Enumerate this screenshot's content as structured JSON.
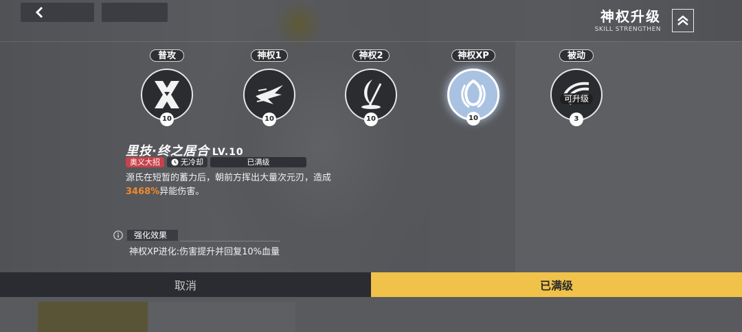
{
  "header": {
    "title": "神权升级",
    "subtitle": "SKILL STRENGTHEN"
  },
  "skills": [
    {
      "label": "普攻",
      "level": "10",
      "icon": "crossed-blades-icon"
    },
    {
      "label": "神权1",
      "level": "10",
      "icon": "dash-strike-icon"
    },
    {
      "label": "神权2",
      "level": "10",
      "icon": "crescent-slash-icon"
    },
    {
      "label": "神权XP",
      "level": "10",
      "icon": "spiral-slash-icon",
      "selected": true
    },
    {
      "label": "被动",
      "level": "3",
      "icon": "claw-burst-icon",
      "badge": "可升级"
    }
  ],
  "detail": {
    "name": "里技·终之居合",
    "level": "LV.10",
    "tag_ultimate": "奥义大招",
    "tag_cooldown": "无冷却",
    "tag_max": "已满级",
    "desc_prefix": "源氏在短暂的蓄力后，朝前方挥出大量次元刃，造成",
    "desc_highlight": "3468%",
    "desc_suffix": "异能伤害。"
  },
  "enhancement": {
    "label": "强化效果",
    "text": "神权XP进化:伤害提升并回复10%血量"
  },
  "buttons": {
    "cancel": "取消",
    "max": "已满级"
  },
  "colors": {
    "accent": "#f0c24a",
    "highlight": "#f08a2c",
    "tag_red": "#c9414a"
  }
}
